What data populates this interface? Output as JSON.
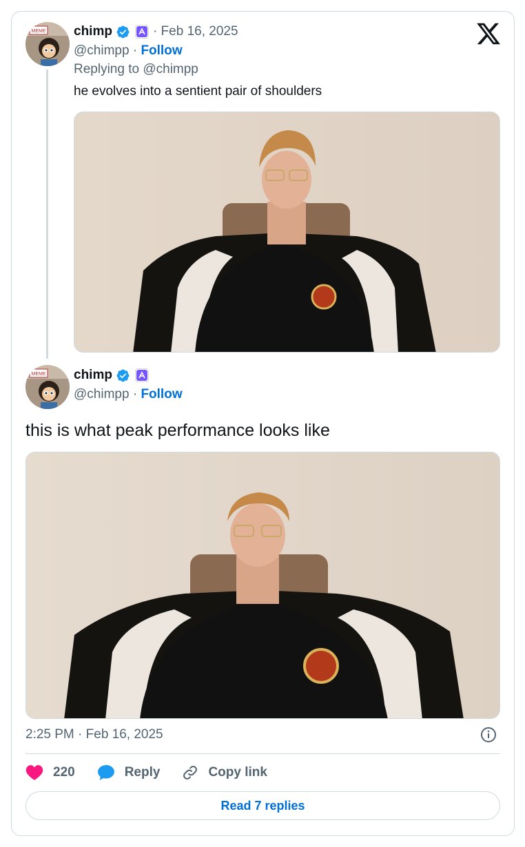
{
  "reply_tweet": {
    "author_name": "chimp",
    "handle": "@chimpp",
    "date": "· Feb 16, 2025",
    "follow_label": "Follow",
    "replying_to": "Replying to @chimpp",
    "text": "he evolves into a sentient pair of shoulders",
    "avatar_sign_text": "MEME"
  },
  "main_tweet": {
    "author_name": "chimp",
    "handle": "@chimpp",
    "follow_label": "Follow",
    "text": "this is what peak performance looks like",
    "timestamp": "2:25 PM · Feb 16, 2025",
    "avatar_sign_text": "MEME"
  },
  "actions": {
    "like_count": "220",
    "reply_label": "Reply",
    "copy_label": "Copy link"
  },
  "read_replies_label": "Read 7 replies",
  "colors": {
    "link_blue": "#006fd6",
    "verified_blue": "#1d9bf0",
    "like_pink": "#f91880",
    "affiliate_purple": "#7856ff"
  },
  "icons": [
    "x-logo-icon",
    "verified-badge-icon",
    "affiliate-badge-icon",
    "heart-icon",
    "reply-bubble-icon",
    "link-icon",
    "info-icon"
  ]
}
